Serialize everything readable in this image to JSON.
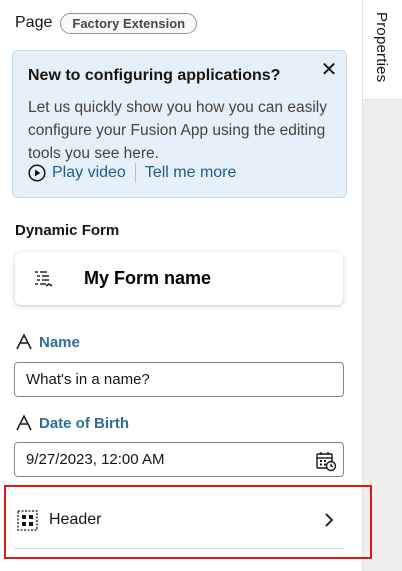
{
  "page": {
    "label": "Page",
    "badge": "Factory Extension"
  },
  "side_tab": {
    "label": "Properties"
  },
  "banner": {
    "title": "New to configuring applications?",
    "body": "Let us quickly show you how you can easily configure your Fusion App using the editing tools you see here.",
    "play_link": "Play video",
    "more_link": "Tell me more"
  },
  "dynamic_form": {
    "label": "Dynamic Form",
    "name": "My Form name"
  },
  "fields": {
    "name": {
      "label": "Name",
      "value": "What's in a name?"
    },
    "dob": {
      "label": "Date of Birth",
      "value": "9/27/2023, 12:00 AM"
    }
  },
  "header_row": {
    "label": "Header"
  },
  "colors": {
    "accent_link": "#1a5f8f",
    "field_label": "#2f6f93",
    "banner_bg": "#e6f0f8",
    "highlight": "#e0171b"
  }
}
